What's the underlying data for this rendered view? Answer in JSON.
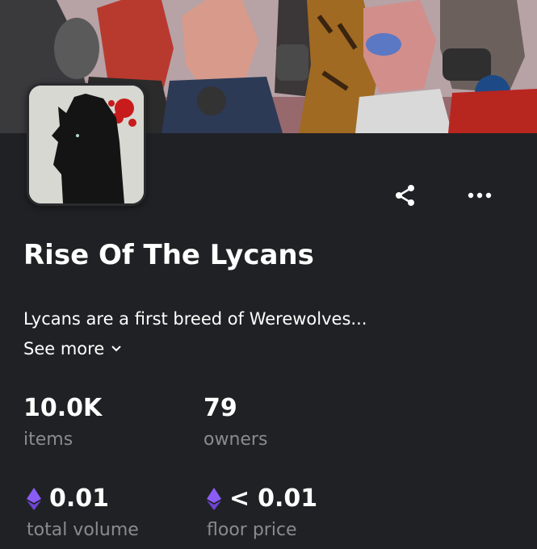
{
  "collection": {
    "name": "Rise Of The Lycans",
    "description": "Lycans are a first breed of Werewolves...",
    "see_more_label": "See more"
  },
  "actions": {
    "share_icon": "share-icon",
    "more_icon": "more-horizontal-icon"
  },
  "stats": {
    "items": {
      "value": "10.0K",
      "label": "items"
    },
    "owners": {
      "value": "79",
      "label": "owners"
    },
    "total_volume": {
      "value": "0.01",
      "label": "total volume",
      "icon": "ethereum-icon"
    },
    "floor_price": {
      "prefix": "<",
      "value": "0.01",
      "label": "floor price",
      "icon": "ethereum-icon"
    }
  },
  "colors": {
    "background": "#202124",
    "text_primary": "#ffffff",
    "text_secondary": "#8a8b8f",
    "ethereum": "#8a5cf6"
  }
}
